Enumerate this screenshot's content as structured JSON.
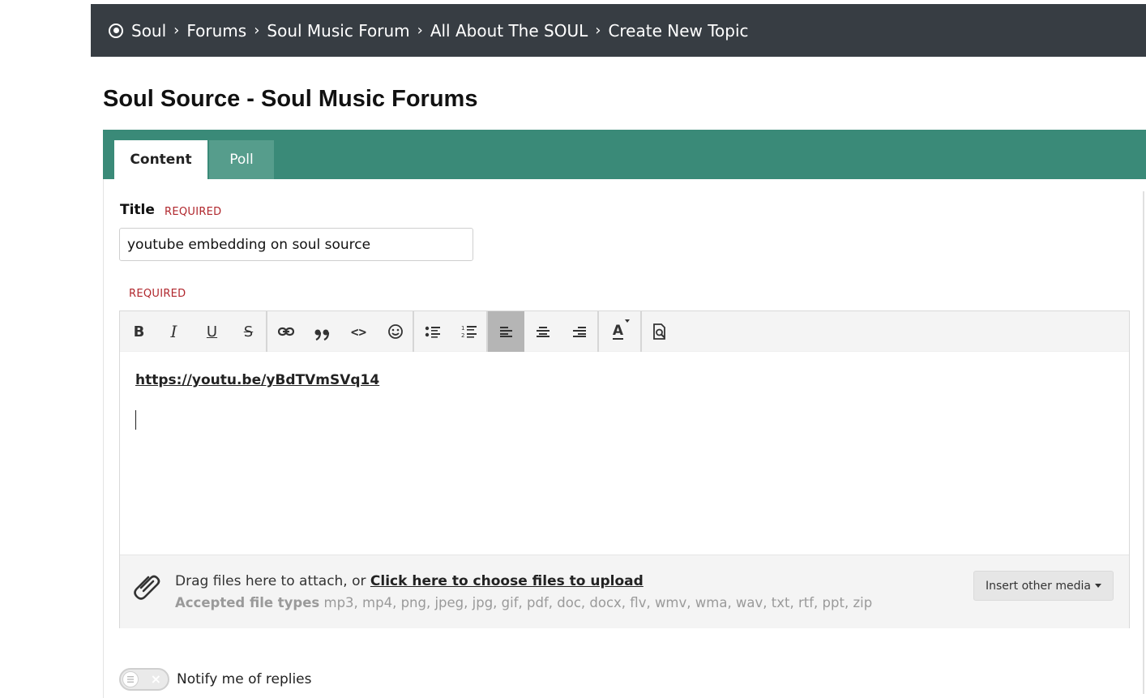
{
  "breadcrumb": {
    "items": [
      {
        "label": "Soul"
      },
      {
        "label": "Forums"
      },
      {
        "label": "Soul Music Forum"
      },
      {
        "label": "All About The SOUL"
      },
      {
        "label": "Create New Topic"
      }
    ],
    "separator": "›"
  },
  "page": {
    "title": "Soul Source - Soul Music Forums"
  },
  "tabs": [
    {
      "label": "Content",
      "active": true
    },
    {
      "label": "Poll",
      "active": false
    }
  ],
  "form": {
    "title_label": "Title",
    "required_text": "REQUIRED",
    "title_value": "youtube embedding on soul source",
    "content_required_text": "REQUIRED"
  },
  "editor": {
    "toolbar": {
      "bold": "B",
      "italic": "I",
      "underline": "U",
      "strike": "S",
      "quote": "❞",
      "code": "<>",
      "font_color": "A",
      "active_button": "align-left"
    },
    "content_link": "https://youtu.be/yBdTVmSVq14"
  },
  "attachments": {
    "drag_text": "Drag files here to attach, or ",
    "choose_link": "Click here to choose files to upload",
    "types_label": "Accepted file types",
    "types_list": " mp3, mp4, png, jpeg, jpg, gif, pdf, doc, docx, flv, wmv, wma, wav, txt, rtf, ppt, zip",
    "insert_media_label": "Insert other media"
  },
  "notify": {
    "label": "Notify me of replies",
    "enabled": false
  },
  "colors": {
    "breadcrumb_bg": "#373d43",
    "tab_bar": "#3a8a78",
    "tab_inactive": "#569d8c",
    "required": "#b0262c"
  }
}
